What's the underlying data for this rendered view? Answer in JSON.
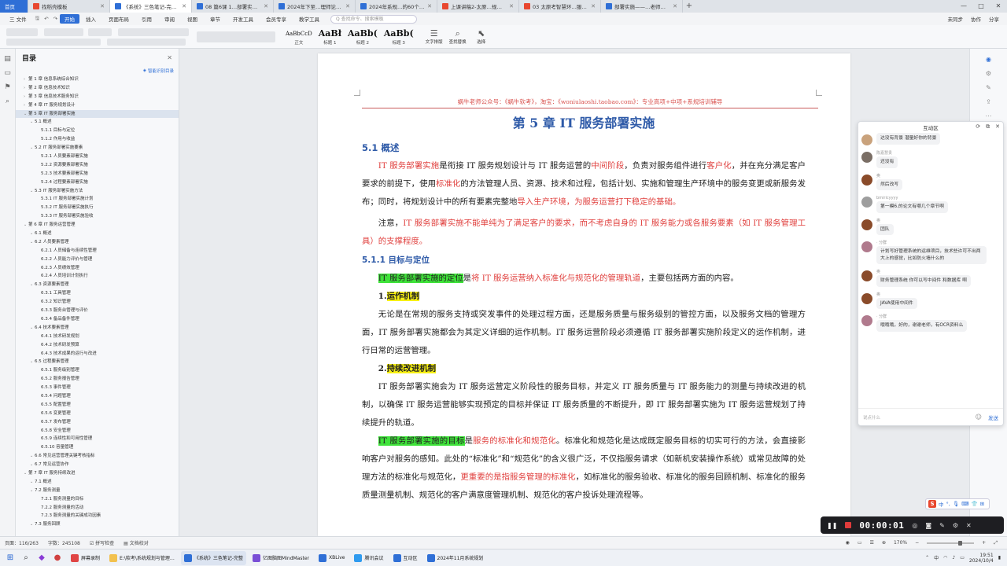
{
  "tabs": [
    {
      "label": "首页",
      "color": "#2f6fd6",
      "home": true
    },
    {
      "label": "找稻壳模板",
      "color": "#e8472f"
    },
    {
      "label": "《系统》三色笔记-完整版.docx",
      "color": "#2f6fd6",
      "active": true
    },
    {
      "label": "08 篇6课 1…部署实施与实运",
      "color": "#2f6fd6"
    },
    {
      "label": "2024年下至…理师论文模拟题",
      "color": "#2f6fd6"
    },
    {
      "label": "2024年系规…的60个选择素材",
      "color": "#2f6fd6"
    },
    {
      "label": "上课讲稿2-太原…规划文件.pdf",
      "color": "#e8472f"
    },
    {
      "label": "03 太原考智慧环…服务内容.pdf",
      "color": "#e8472f"
    },
    {
      "label": "部署实施——…老师漫谈论文",
      "color": "#2f6fd6"
    }
  ],
  "menu": {
    "file": "三 文件",
    "items": [
      "开始",
      "插入",
      "页面布局",
      "引用",
      "审阅",
      "视图",
      "章节",
      "开发工具",
      "会员专享",
      "教学工具"
    ],
    "active_index": 0,
    "search_placeholder": "Q 查找命令、搜索模板",
    "right": [
      "未同步",
      "协作",
      "分享"
    ]
  },
  "ribbon": {
    "styles": [
      {
        "sample": "AaBbCcD",
        "label": "正文",
        "small": true
      },
      {
        "sample": "AaBł",
        "label": "标题 1"
      },
      {
        "sample": "AaBb(",
        "label": "标题 2"
      },
      {
        "sample": "AaBb(",
        "label": "标题 3"
      }
    ],
    "tools": [
      {
        "icon": "☰",
        "label": "文字排版"
      },
      {
        "icon": "⌕",
        "label": "查找替换"
      },
      {
        "icon": "⬉",
        "label": "选择"
      }
    ]
  },
  "toc": {
    "title": "目录",
    "smart": "智能识别目录",
    "items": [
      {
        "text": "第 1 章  信息系统综合知识",
        "level": 0,
        "collapsed": true
      },
      {
        "text": "第 2 章  信息技术知识",
        "level": 0,
        "collapsed": true
      },
      {
        "text": "第 3 章  信息技术服务知识",
        "level": 0,
        "collapsed": true
      },
      {
        "text": "第 4 章  IT 服务规划设计",
        "level": 0,
        "collapsed": true
      },
      {
        "text": "第 5 章  IT 服务部署实施",
        "level": 0,
        "active": true
      },
      {
        "text": "5.1  概述",
        "level": 1
      },
      {
        "text": "5.1.1  目标与定位",
        "level": 2
      },
      {
        "text": "5.1.2  作用与收益",
        "level": 2
      },
      {
        "text": "5.2  IT 服务部署实施要素",
        "level": 1
      },
      {
        "text": "5.2.1  人员要素部署实施",
        "level": 2
      },
      {
        "text": "5.2.2  资源要素部署实施",
        "level": 2
      },
      {
        "text": "5.2.3  技术要素部署实施",
        "level": 2
      },
      {
        "text": "5.2.4  过程要素部署实施",
        "level": 2
      },
      {
        "text": "5.3  IT 服务部署实施方法",
        "level": 1
      },
      {
        "text": "5.3.1  IT 服务部署实施计划",
        "level": 2
      },
      {
        "text": "5.3.2  IT 服务部署实施执行",
        "level": 2
      },
      {
        "text": "5.3.3  IT 服务部署实施验收",
        "level": 2
      },
      {
        "text": "第 6 章  IT 服务运营管理",
        "level": 0
      },
      {
        "text": "6.1  概述",
        "level": 1
      },
      {
        "text": "6.2  人员要素管理",
        "level": 1
      },
      {
        "text": "6.2.1  人员储备与连续性管理",
        "level": 2
      },
      {
        "text": "6.2.2  人员能力评价与管理",
        "level": 2
      },
      {
        "text": "6.2.3  人员绩效管理",
        "level": 2
      },
      {
        "text": "6.2.4  人员培训计划执行",
        "level": 2
      },
      {
        "text": "6.3  资源要素管理",
        "level": 1
      },
      {
        "text": "6.3.1  工具管理",
        "level": 2
      },
      {
        "text": "6.3.2  知识管理",
        "level": 2
      },
      {
        "text": "6.3.3  服务台管理与评价",
        "level": 2
      },
      {
        "text": "6.3.4  备品备件管理",
        "level": 2
      },
      {
        "text": "6.4  技术要素管理",
        "level": 1
      },
      {
        "text": "6.4.1  技术研发规划",
        "level": 2
      },
      {
        "text": "6.4.2  技术研发预算",
        "level": 2
      },
      {
        "text": "6.4.3  技术成果的运行与改进",
        "level": 2
      },
      {
        "text": "6.5  过程要素管理",
        "level": 1
      },
      {
        "text": "6.5.1  服务级别管理",
        "level": 2
      },
      {
        "text": "6.5.2  服务报告管理",
        "level": 2
      },
      {
        "text": "6.5.3  事件管理",
        "level": 2
      },
      {
        "text": "6.5.4  问题管理",
        "level": 2
      },
      {
        "text": "6.5.5  配置管理",
        "level": 2
      },
      {
        "text": "6.5.6  变更管理",
        "level": 2
      },
      {
        "text": "6.5.7  发布管理",
        "level": 2
      },
      {
        "text": "6.5.8  安全管理",
        "level": 2
      },
      {
        "text": "6.5.9  连续性和可用性管理",
        "level": 2
      },
      {
        "text": "6.5.10  容量管理",
        "level": 2
      },
      {
        "text": "6.6  常见运营管理关键考核指标",
        "level": 1
      },
      {
        "text": "6.7  常见运营协作",
        "level": 1
      },
      {
        "text": "第 7 章  IT 服务持续改进",
        "level": 0
      },
      {
        "text": "7.1  概述",
        "level": 1
      },
      {
        "text": "7.2  服务测量",
        "level": 1
      },
      {
        "text": "7.2.1  服务测量的目标",
        "level": 2
      },
      {
        "text": "7.2.2  服务测量的活动",
        "level": 2
      },
      {
        "text": "7.2.3  服务测量的关键成功因素",
        "level": 2
      },
      {
        "text": "7.3  服务回顾",
        "level": 1
      }
    ]
  },
  "doc": {
    "header": "蜗牛老师公众号：《蜗牛软考》，淘宝：《woniulaoshi.taobao.com》：专业高项+中项+系规培训辅导",
    "chapter_title": "第 5 章  IT 服务部署实施",
    "s51": "5.1  概述",
    "p1a": "IT 服务部署实施",
    "p1b": "是衔接 IT 服务规划设计与 IT 服务运营的",
    "p1c": "中间阶段",
    "p1d": "，负责对服务组件进行",
    "p1e": "客户化",
    "p1f": "，并在充分满足客户要求的前提下，使用",
    "p1g": "标准化",
    "p1h": "的方法管理人员、资源、技术和过程，包括计划、实施和管理生产环境中的服务变更或新服务发布；同时，将规划设计中的所有要素完整地",
    "p1i": "导入生产环境，为服务运营打下稳定的基础。",
    "p2a": "注意，",
    "p2b": "IT 服务部署实施不能单纯为了满足客户的要求，而不考虑自身的 IT 服务能力或各服务要素（如 IT 服务管理工具）的支撑程度。",
    "s511": "5.1.1  目标与定位",
    "p3a": "IT 服务部署实施的定位",
    "p3b": "是",
    "p3c": "将 IT 服务运营纳入标准化与规范化的管理轨道",
    "p3d": "，主要包括两方面的内容。",
    "n1": "1.",
    "n1t": "运作机制",
    "p4": "无论是在常规的服务支持或突发事件的处理过程方面，还是服务质量与服务级别的管控方面，以及服务文档的管理方面，IT 服务部署实施都会为其定义详细的运作机制。IT 服务运营阶段必须遵循 IT 服务部署实施阶段定义的运作机制，进行日常的运营管理。",
    "n2": "2.",
    "n2t": "持续改进机制",
    "p5": "IT 服务部署实施会为 IT 服务运营定义阶段性的服务目标，并定义 IT 服务质量与 IT 服务能力的测量与持续改进的机制，以确保 IT 服务运营能够实现预定的目标并保证 IT 服务质量的不断提升，即 IT 服务部署实施为 IT 服务运营规划了持续提升的轨道。",
    "p6a": "IT 服务部署实施的目标",
    "p6b": "是",
    "p6c": "服务的标准化和规范化",
    "p6d": "。标准化和规范化是达成既定服务目标的切实可行的方法，会直接影响客户对服务的感知。此处的“标准化”和“规范化”的含义很广泛，不仅指服务请求（如新机安装操作系统）或常见故障的处理方法的标准化与规范化，",
    "p6e": "更重要的是指服务管理的标准化",
    "p6f": "，如标准化的服务验收、标准化的服务回顾机制、标准化的服务质量测量机制、规范化的客户满意度管理机制、规范化的客户投诉处理流程等。"
  },
  "chat": {
    "title": "互动区",
    "messages": [
      {
        "name": "",
        "text": "达没有背景 潜量好你的背景",
        "color": "#c9a27c"
      },
      {
        "name": "陈嘉慧贵",
        "text": "还没有",
        "color": "#7a6e65"
      },
      {
        "name": "奥",
        "text": "然后改写",
        "color": "#8a4b2a"
      },
      {
        "name": "bmiricyyyy",
        "text": "第一模6.的论文有哪几个章节啊",
        "color": "#9e9e9e"
      },
      {
        "name": "奥",
        "text": "团队",
        "color": "#8a4b2a"
      },
      {
        "name": "· 分群",
        "text": "计划写好管理系统的运维项目，技术些许可不出两大上的感觉，比如防火墙什么的",
        "color": "#b07a8d"
      },
      {
        "name": "奥",
        "text": "财务管理系统 你可以写中间件 和数据库 啊",
        "color": "#8a4b2a"
      },
      {
        "name": "奥",
        "text": "JAVA使用中间件",
        "color": "#8a4b2a"
      },
      {
        "name": "· 分群",
        "text": "哦哦哦，好的，谢谢老师，有OCR资料么",
        "color": "#b07a8d"
      }
    ],
    "input_placeholder": "说点什么",
    "send_label": "发送"
  },
  "recorder": {
    "time": "00:00:01"
  },
  "ime": {
    "logo": "S",
    "mode": "中"
  },
  "status": {
    "page": "页面：116/263",
    "words": "字数：245108",
    "spell": "拼写检查",
    "proof": "文档校对",
    "zoom": "170%"
  },
  "taskbar": {
    "items": [
      {
        "label": "屏幕录制",
        "color": "#e04545"
      },
      {
        "label": "E:\\软考\\系统规划与管理…",
        "color": "#f2c14e"
      },
      {
        "label": "《系统》三色笔记-完整",
        "color": "#2f6fd6",
        "active": true
      },
      {
        "label": "亿图脑图MindMaster",
        "color": "#7a4fd6"
      },
      {
        "label": "XBLive",
        "color": "#2f6fd6"
      },
      {
        "label": "腾讯会议",
        "color": "#2f9bef"
      },
      {
        "label": "互动区",
        "color": "#2f6fd6"
      },
      {
        "label": "2024年11月系统规划",
        "color": "#2f6fd6"
      }
    ],
    "time": "19:51",
    "date": "2024/10/4",
    "lang": "中"
  }
}
